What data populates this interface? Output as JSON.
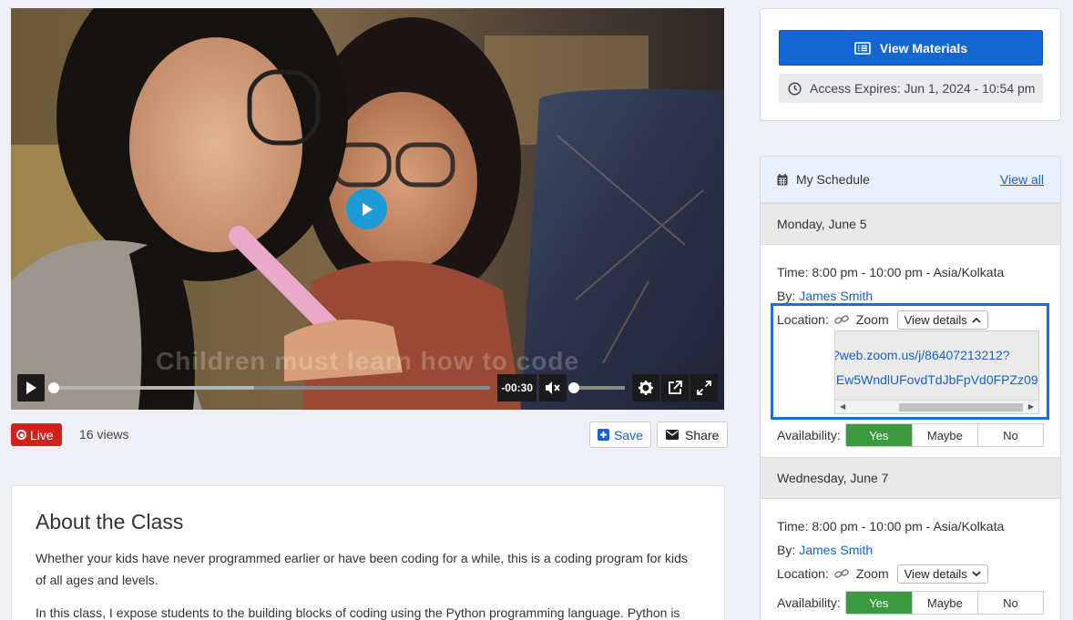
{
  "video": {
    "caption": "Children must learn how to code",
    "time_remaining": "-00:30",
    "progress": 0.0,
    "buffered": 0.46,
    "volume": 0.0
  },
  "meta": {
    "live_label": "Live",
    "views": "16 views",
    "save_label": "Save",
    "share_label": "Share"
  },
  "about": {
    "title": "About the Class",
    "p1": "Whether your kids have never programmed earlier or have been coding for a while, this is a coding program for kids of all ages and levels.",
    "p2": "In this class, I expose students to the building blocks of coding using the Python programming language. Python is"
  },
  "actions": {
    "materials_label": "View Materials",
    "access_expires": "Access Expires: Jun 1, 2024 - 10:54 pm"
  },
  "schedule": {
    "title": "My Schedule",
    "view_all": "View all",
    "days": [
      {
        "date": "Monday, June 5",
        "time": "Time: 8:00 pm - 10:00 pm - Asia/Kolkata",
        "by_label": "By:",
        "instructor": "James Smith",
        "location_label": "Location:",
        "location": "Zoom",
        "details_label": "View details",
        "url_line1": "?web.zoom.us/j/86407213212?",
        "url_line2": ":Ew5WndlUFovdTdJbFpVd0FPZz09",
        "availability_label": "Availability:",
        "options": [
          "Yes",
          "Maybe",
          "No"
        ]
      },
      {
        "date": "Wednesday, June 7",
        "time": "Time: 8:00 pm - 10:00 pm - Asia/Kolkata",
        "by_label": "By:",
        "instructor": "James Smith",
        "location_label": "Location:",
        "location": "Zoom",
        "details_label": "View details",
        "availability_label": "Availability:",
        "options": [
          "Yes",
          "Maybe",
          "No"
        ]
      }
    ]
  },
  "colors": {
    "accent_blue": "#1467d1",
    "live_red": "#d1211c",
    "yes_green": "#3b9a3f"
  }
}
